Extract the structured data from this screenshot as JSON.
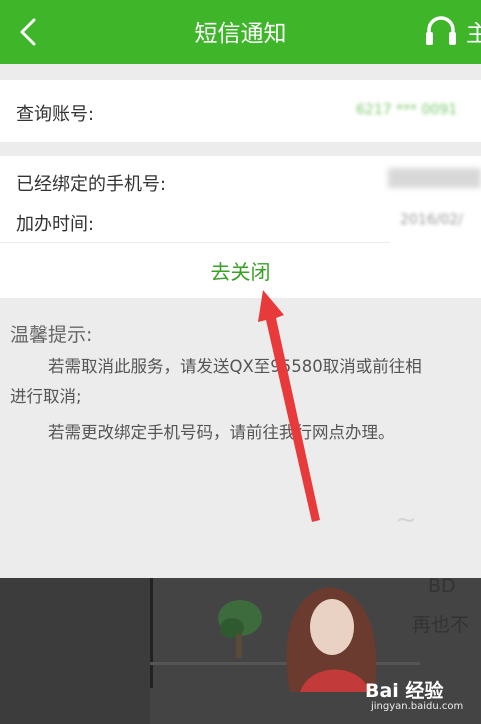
{
  "header": {
    "title": "短信通知",
    "right_label": "主"
  },
  "account": {
    "label": "查询账号:",
    "value": "6217 *** 0091"
  },
  "phone": {
    "label": "已经绑定的手机号:",
    "value": ""
  },
  "date": {
    "label": "加办时间:",
    "value": "2016/02/"
  },
  "close_button": "去关闭",
  "tips": {
    "heading": "温馨提示:",
    "line1": "若需取消此服务，请发送QX至95580取消或前往相",
    "line2": "进行取消;",
    "line3": "若需更改绑定手机号码，请前往我行网点办理。"
  },
  "background_art": {
    "handwriting_top": "~",
    "handwriting_1": "再也不",
    "handwriting_2": "BD"
  },
  "watermark": {
    "brand": "Bai 经验",
    "url": "jingyan.baidu.com"
  },
  "colors": {
    "header": "#3fb52a",
    "accent": "#3aa027",
    "arrow": "#e8393b"
  },
  "icons": [
    "back-arrow-icon",
    "headset-icon"
  ]
}
